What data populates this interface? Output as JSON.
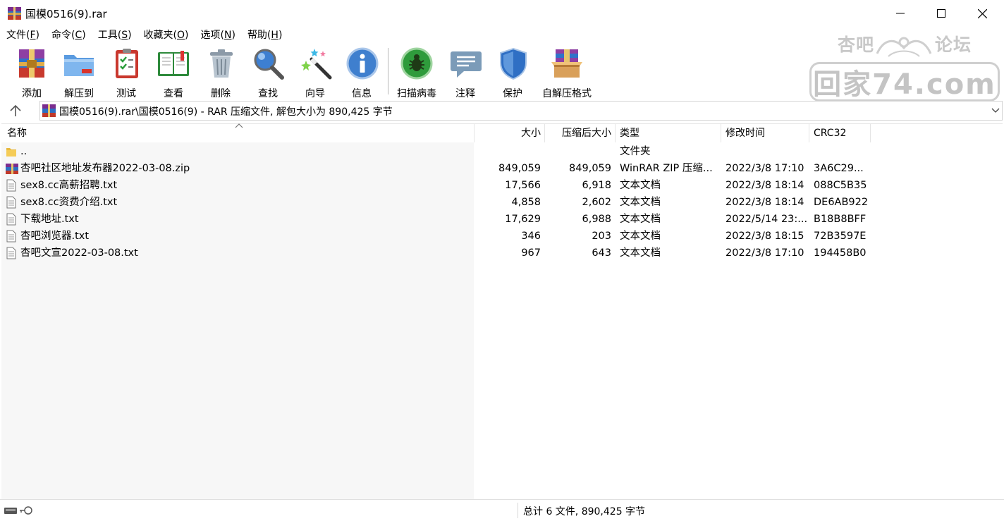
{
  "window": {
    "title": "国模0516(9).rar",
    "minimize_icon": "minimize-icon",
    "maximize_icon": "maximize-icon",
    "close_icon": "close-icon"
  },
  "menu": [
    {
      "label": "文件(",
      "key": "F",
      "end": ")"
    },
    {
      "label": "命令(",
      "key": "C",
      "end": ")"
    },
    {
      "label": "工具(",
      "key": "S",
      "end": ")"
    },
    {
      "label": "收藏夹(",
      "key": "O",
      "end": ")"
    },
    {
      "label": "选项(",
      "key": "N",
      "end": ")"
    },
    {
      "label": "帮助(",
      "key": "H",
      "end": ")"
    }
  ],
  "watermark": {
    "top_left": "杏吧",
    "top_right": "论坛",
    "main": "回家74.com"
  },
  "toolbar": [
    {
      "label": "添加",
      "icon": "add-archive-icon"
    },
    {
      "label": "解压到",
      "icon": "extract-to-icon"
    },
    {
      "label": "测试",
      "icon": "test-icon"
    },
    {
      "label": "查看",
      "icon": "view-book-icon"
    },
    {
      "label": "删除",
      "icon": "trash-icon"
    },
    {
      "label": "查找",
      "icon": "magnifier-icon"
    },
    {
      "label": "向导",
      "icon": "wizard-wand-icon"
    },
    {
      "label": "信息",
      "icon": "info-icon"
    },
    {
      "label": "扫描病毒",
      "icon": "virus-scan-icon"
    },
    {
      "label": "注释",
      "icon": "comment-icon"
    },
    {
      "label": "保护",
      "icon": "shield-icon"
    },
    {
      "label": "自解压格式",
      "icon": "sfx-box-icon"
    }
  ],
  "address": {
    "text": "国模0516(9).rar\\国模0516(9) - RAR 压缩文件, 解包大小为 890,425 字节"
  },
  "columns": {
    "name": "名称",
    "size": "大小",
    "packed": "压缩后大小",
    "type": "类型",
    "modified": "修改时间",
    "crc": "CRC32"
  },
  "files": [
    {
      "name": "..",
      "size": "",
      "packed": "",
      "type": "文件夹",
      "modified": "",
      "crc": "",
      "icon": "folder-icon"
    },
    {
      "name": "杏吧社区地址发布器2022-03-08.zip",
      "size": "849,059",
      "packed": "849,059",
      "type": "WinRAR ZIP 压缩...",
      "modified": "2022/3/8 17:10",
      "crc": "3A6C29...",
      "icon": "zip-archive-icon"
    },
    {
      "name": "sex8.cc高薪招聘.txt",
      "size": "17,566",
      "packed": "6,918",
      "type": "文本文档",
      "modified": "2022/3/8 18:14",
      "crc": "088C5B35",
      "icon": "text-file-icon"
    },
    {
      "name": "sex8.cc资费介绍.txt",
      "size": "4,858",
      "packed": "2,602",
      "type": "文本文档",
      "modified": "2022/3/8 18:14",
      "crc": "DE6AB922",
      "icon": "text-file-icon"
    },
    {
      "name": "下载地址.txt",
      "size": "17,629",
      "packed": "6,988",
      "type": "文本文档",
      "modified": "2022/5/14 23:...",
      "crc": "B18B8BFF",
      "icon": "text-file-icon"
    },
    {
      "name": "杏吧浏览器.txt",
      "size": "346",
      "packed": "203",
      "type": "文本文档",
      "modified": "2022/3/8 18:15",
      "crc": "72B3597E",
      "icon": "text-file-icon"
    },
    {
      "name": "杏吧文宣2022-03-08.txt",
      "size": "967",
      "packed": "643",
      "type": "文本文档",
      "modified": "2022/3/8 17:10",
      "crc": "194458B0",
      "icon": "text-file-icon"
    }
  ],
  "status": {
    "text": "总计 6 文件, 890,425 字节"
  }
}
